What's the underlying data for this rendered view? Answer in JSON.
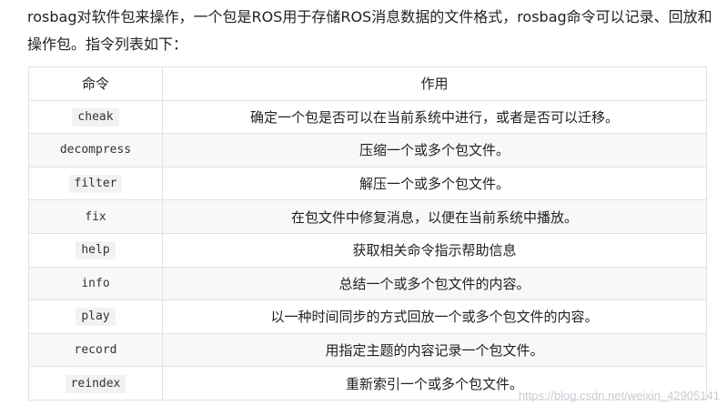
{
  "intro": {
    "text": "rosbag对软件包来操作，一个包是ROS用于存储ROS消息数据的文件格式，rosbag命令可以记录、回放和操作包。指令列表如下："
  },
  "table": {
    "headers": [
      "命令",
      "作用"
    ],
    "rows": [
      {
        "command": "cheak",
        "description": "确定一个包是否可以在当前系统中进行，或者是否可以迁移。"
      },
      {
        "command": "decompress",
        "description": "压缩一个或多个包文件。"
      },
      {
        "command": "filter",
        "description": "解压一个或多个包文件。"
      },
      {
        "command": "fix",
        "description": "在包文件中修复消息，以便在当前系统中播放。"
      },
      {
        "command": "help",
        "description": "获取相关命令指示帮助信息"
      },
      {
        "command": "info",
        "description": "总结一个或多个包文件的内容。"
      },
      {
        "command": "play",
        "description": "以一种时间同步的方式回放一个或多个包文件的内容。"
      },
      {
        "command": "record",
        "description": "用指定主题的内容记录一个包文件。"
      },
      {
        "command": "reindex",
        "description": "重新索引一个或多个包文件。"
      }
    ]
  },
  "watermark": "https://blog.csdn.net/weixin_42905141"
}
